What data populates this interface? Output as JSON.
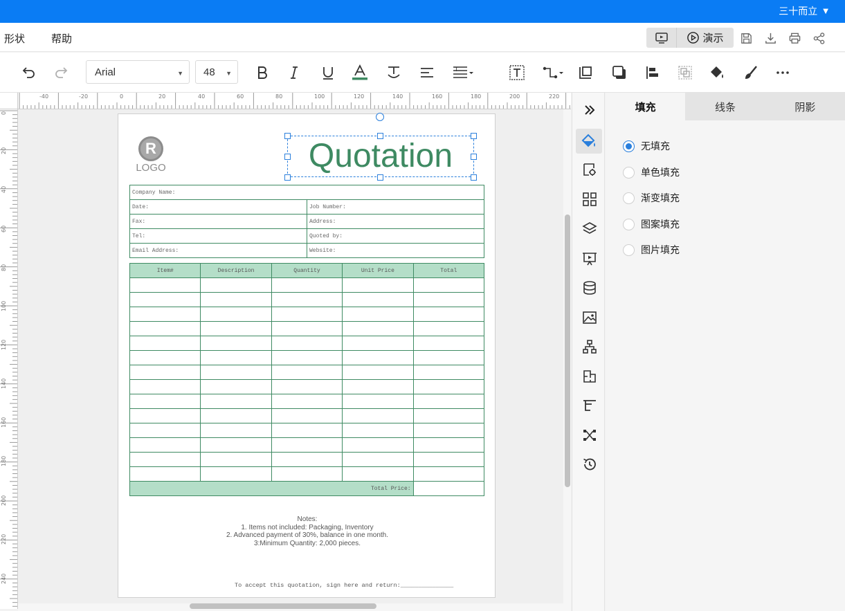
{
  "user": {
    "name": "三十而立"
  },
  "menu": {
    "shape": "形状",
    "help": "帮助",
    "present": "演示"
  },
  "toolbar": {
    "font": "Arial",
    "size": "48"
  },
  "ruler": {
    "h_labels": [
      "-40",
      "-20",
      "0",
      "20",
      "40",
      "60",
      "80",
      "100",
      "120",
      "140",
      "160",
      "180",
      "200",
      "220"
    ],
    "v_labels": [
      "0",
      "20",
      "40",
      "60",
      "80",
      "100",
      "120",
      "140",
      "160",
      "180",
      "200",
      "220",
      "240"
    ]
  },
  "doc": {
    "logo_text": "LOGO",
    "title": "Quotation",
    "info": {
      "company": "Company Name:",
      "date": "Date:",
      "job": "Job Number:",
      "fax": "Fax:",
      "address": "Address:",
      "tel": "Tel:",
      "quoted": "Quoted by:",
      "email": "Email Address:",
      "website": "Website:"
    },
    "columns": [
      "Item#",
      "Description",
      "Quantity",
      "Unit Price",
      "Total"
    ],
    "total_label": "Total Price:",
    "notes": {
      "title": "Notes:",
      "line1": "1. Items not included: Packaging, Inventory",
      "line2": "2. Advanced payment of 30%, balance in one month.",
      "line3": "3:Minimum Quantity: 2,000 pieces."
    },
    "sign": "To accept this quotation, sign here and return:_______________"
  },
  "panel": {
    "tabs": [
      "填充",
      "线条",
      "阴影"
    ],
    "options": [
      "无填充",
      "单色填充",
      "渐变填充",
      "图案填充",
      "图片填充"
    ]
  },
  "colors": {
    "accent": "#0a7cf4",
    "green": "#3e8a62",
    "header_fill": "#b4dec8"
  }
}
